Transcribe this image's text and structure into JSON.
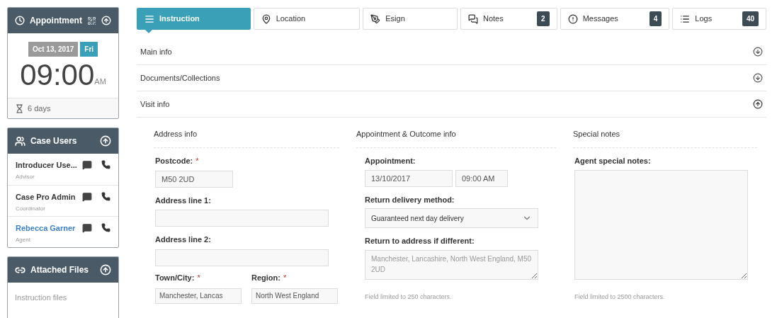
{
  "appointment_panel": {
    "title": "Appointment",
    "date": "Oct 13, 2017",
    "weekday": "Fri",
    "time": "09:00",
    "meridiem": "AM",
    "countdown": "6 days"
  },
  "case_users_panel": {
    "title": "Case Users",
    "users": [
      {
        "name": "Introducer Use...",
        "role": "Advisor",
        "selected": false
      },
      {
        "name": "Case Pro Admin",
        "role": "Coordinator",
        "selected": false
      },
      {
        "name": "Rebecca Garner",
        "role": "Agent",
        "selected": true
      }
    ]
  },
  "attached_files_panel": {
    "title": "Attached Files",
    "items": [
      "Instruction files"
    ]
  },
  "tabs": [
    {
      "label": "Instruction",
      "selected": true
    },
    {
      "label": "Location",
      "selected": false
    },
    {
      "label": "Esign",
      "selected": false
    },
    {
      "label": "Notes",
      "selected": false,
      "count": "2"
    },
    {
      "label": "Messages",
      "selected": false,
      "count": "4"
    },
    {
      "label": "Logs",
      "selected": false,
      "count": "40"
    }
  ],
  "sections": [
    {
      "title": "Main info",
      "expanded": false
    },
    {
      "title": "Documents/Collections",
      "expanded": false
    },
    {
      "title": "Visit info",
      "expanded": true
    }
  ],
  "visit_info": {
    "address": {
      "heading": "Address info",
      "postcode_label": "Postcode:",
      "postcode": "M50 2UD",
      "line1_label": "Address line 1:",
      "line2_label": "Address line 2:",
      "town_label": "Town/City:",
      "town": "Manchester, Lancas",
      "region_label": "Region:",
      "region": "North West England",
      "required_mark": "*"
    },
    "appointment": {
      "heading": "Appointment & Outcome info",
      "appointment_label": "Appointment:",
      "date": "13/10/2017",
      "time": "09:00 AM",
      "delivery_label": "Return delivery method:",
      "delivery": "Guaranteed next day delivery",
      "return_label": "Return to address if different:",
      "return_placeholder": "Manchester, Lancashire, North West England, M50 2UD",
      "hint": "Field limited to 250 characters."
    },
    "special": {
      "heading": "Special notes",
      "notes_label": "Agent special notes:",
      "hint": "Field limited to 2500 characters."
    }
  }
}
